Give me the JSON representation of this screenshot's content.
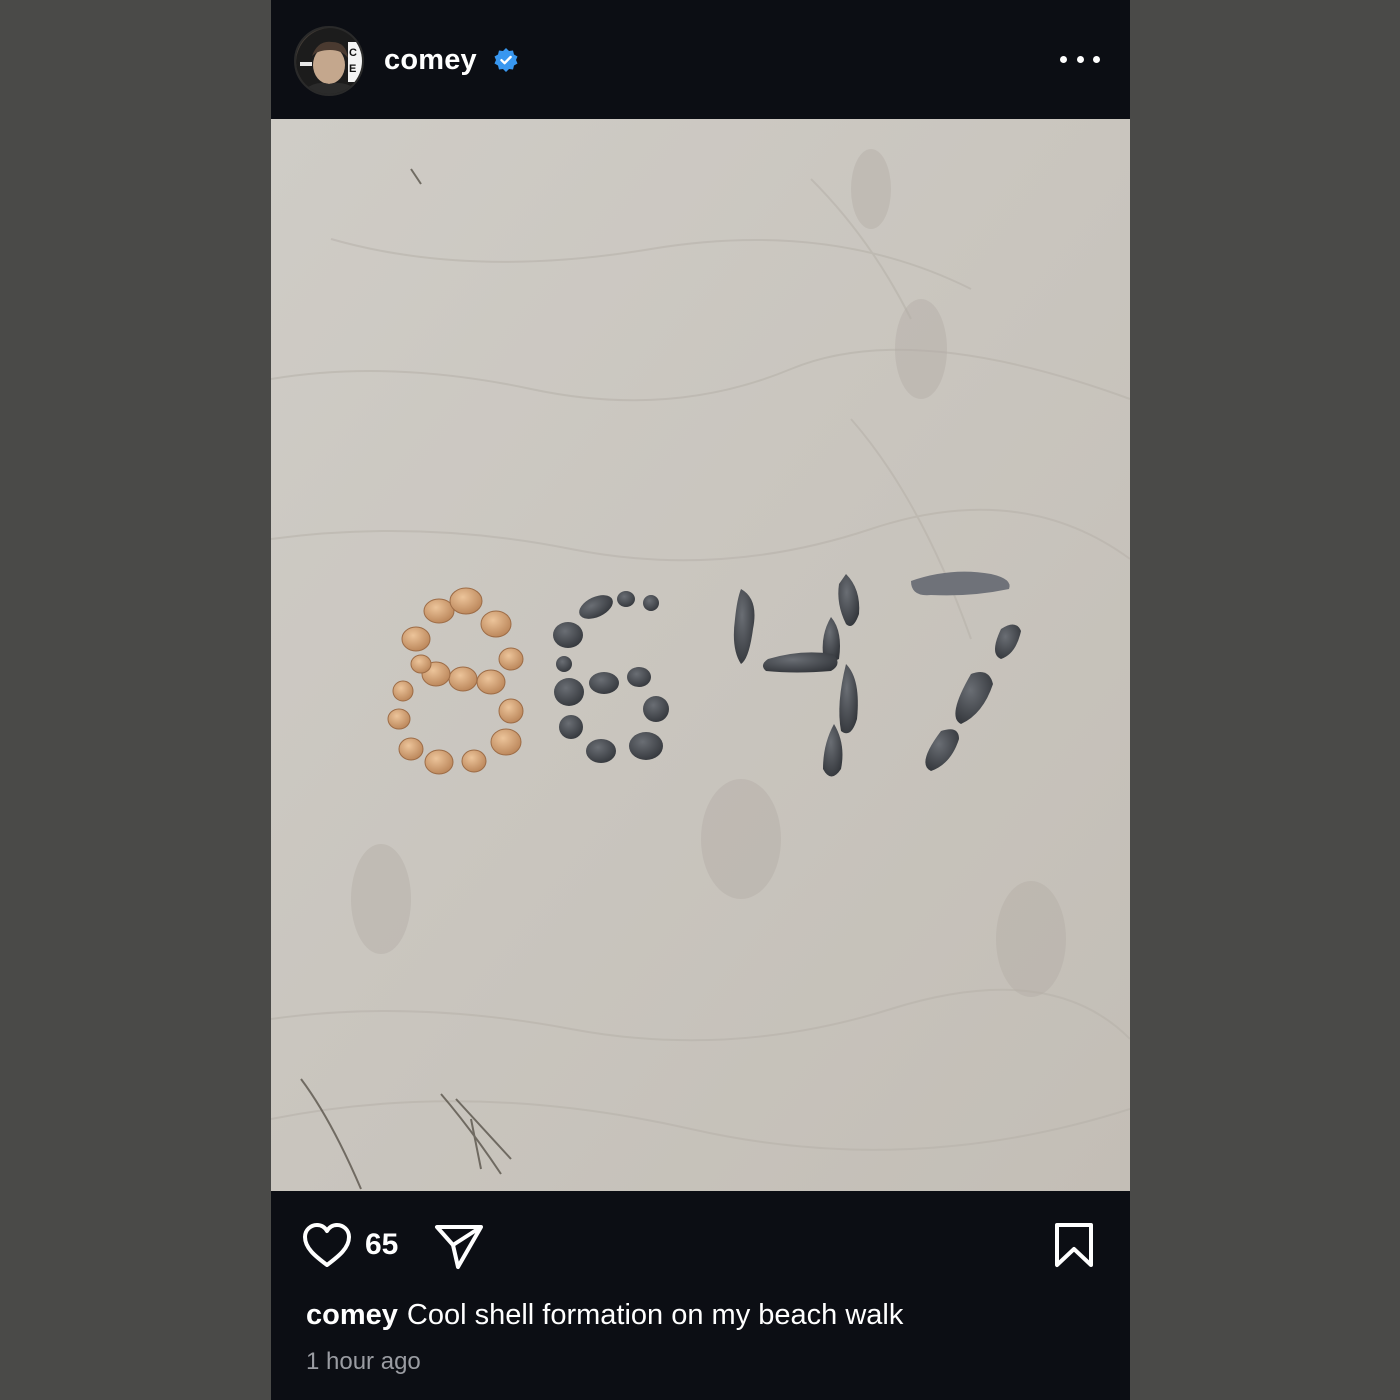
{
  "post": {
    "username": "comey",
    "verified": true,
    "accent_color": "#3897f0",
    "more_icon": "more-horizontal-icon",
    "image_alt": "",
    "likes": "65",
    "caption_user": "comey",
    "caption_text": "Cool shell formation on my beach walk",
    "timestamp": "1 hour ago"
  },
  "icons": {
    "like": "heart-icon",
    "share": "paper-plane-icon",
    "save": "bookmark-icon",
    "verified": "verified-badge-icon"
  }
}
